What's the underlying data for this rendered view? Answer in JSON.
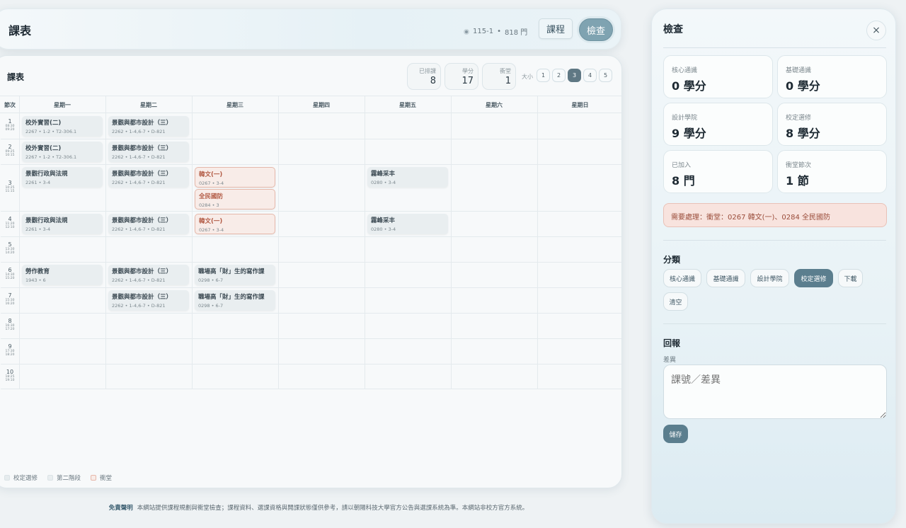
{
  "header": {
    "title": "課表",
    "term": "115-1",
    "term_sep": "•",
    "course_count": "818 門",
    "nav": [
      {
        "label": "課程"
      },
      {
        "label": "檢查"
      }
    ]
  },
  "schedule": {
    "title": "課表",
    "stats": [
      {
        "label": "已排課",
        "value": "8"
      },
      {
        "label": "學分",
        "value": "17"
      },
      {
        "label": "衝堂",
        "value": "1"
      }
    ],
    "size_label": "大小",
    "sizes": [
      "1",
      "2",
      "3",
      "4",
      "5"
    ],
    "selected_size": "3",
    "period_header": "節次",
    "days": [
      "星期一",
      "星期二",
      "星期三",
      "星期四",
      "星期五",
      "星期六",
      "星期日"
    ],
    "periods": [
      {
        "n": "1",
        "start": "08:30",
        "end": "09:20"
      },
      {
        "n": "2",
        "start": "09:25",
        "end": "10:15"
      },
      {
        "n": "3",
        "start": "10:25",
        "end": "11:15"
      },
      {
        "n": "4",
        "start": "11:20",
        "end": "12:10"
      },
      {
        "n": "5",
        "start": "13:30",
        "end": "14:20"
      },
      {
        "n": "6",
        "start": "14:30",
        "end": "15:20"
      },
      {
        "n": "7",
        "start": "15:30",
        "end": "16:20"
      },
      {
        "n": "8",
        "start": "16:30",
        "end": "17:20"
      },
      {
        "n": "9",
        "start": "17:30",
        "end": "18:20"
      },
      {
        "n": "10",
        "start": "18:25",
        "end": "19:10"
      }
    ],
    "courses": [
      {
        "name": "校外實習(二)",
        "meta": "2267 • 1-2 • T2-306.1",
        "day": 0,
        "period": 0,
        "slot": 0,
        "conflict": false
      },
      {
        "name": "校外實習(二)",
        "meta": "2267 • 1-2 • T2-306.1",
        "day": 0,
        "period": 1,
        "slot": 0,
        "conflict": false
      },
      {
        "name": "景觀行政與法規",
        "meta": "2261 • 3-4",
        "day": 0,
        "period": 2,
        "slot": 0,
        "conflict": false
      },
      {
        "name": "景觀行政與法規",
        "meta": "2261 • 3-4",
        "day": 0,
        "period": 3,
        "slot": 0,
        "conflict": false
      },
      {
        "name": "勞作教育",
        "meta": "1943 • 6",
        "day": 0,
        "period": 5,
        "slot": 0,
        "conflict": false
      },
      {
        "name": "景觀與都市設計（三）",
        "meta": "2262 • 1-4,6-7 • D-821",
        "day": 1,
        "period": 0,
        "slot": 0,
        "conflict": false
      },
      {
        "name": "景觀與都市設計（三）",
        "meta": "2262 • 1-4,6-7 • D-821",
        "day": 1,
        "period": 1,
        "slot": 0,
        "conflict": false
      },
      {
        "name": "景觀與都市設計（三）",
        "meta": "2262 • 1-4,6-7 • D-821",
        "day": 1,
        "period": 2,
        "slot": 0,
        "conflict": false
      },
      {
        "name": "景觀與都市設計（三）",
        "meta": "2262 • 1-4,6-7 • D-821",
        "day": 1,
        "period": 3,
        "slot": 0,
        "conflict": false
      },
      {
        "name": "景觀與都市設計（三）",
        "meta": "2262 • 1-4,6-7 • D-821",
        "day": 1,
        "period": 5,
        "slot": 0,
        "conflict": false
      },
      {
        "name": "景觀與都市設計（三）",
        "meta": "2262 • 1-4,6-7 • D-821",
        "day": 1,
        "period": 6,
        "slot": 0,
        "conflict": false
      },
      {
        "name": "韓文(一)",
        "meta": "0267 • 3-4",
        "day": 2,
        "period": 2,
        "slot": 0,
        "conflict": true
      },
      {
        "name": "全民國防",
        "meta": "0284 • 3",
        "day": 2,
        "period": 2,
        "slot": 1,
        "conflict": true
      },
      {
        "name": "韓文(一)",
        "meta": "0267 • 3-4",
        "day": 2,
        "period": 3,
        "slot": 0,
        "conflict": true
      },
      {
        "name": "職場高「財」生的寫作課",
        "meta": "0298 • 6-7",
        "day": 2,
        "period": 5,
        "slot": 0,
        "conflict": false
      },
      {
        "name": "職場高「財」生的寫作課",
        "meta": "0298 • 6-7",
        "day": 2,
        "period": 6,
        "slot": 0,
        "conflict": false
      },
      {
        "name": "霧峰采丰",
        "meta": "0280 • 3-4",
        "day": 4,
        "period": 2,
        "slot": 0,
        "conflict": false
      },
      {
        "name": "霧峰采丰",
        "meta": "0280 • 3-4",
        "day": 4,
        "period": 3,
        "slot": 0,
        "conflict": false
      }
    ],
    "legend": [
      {
        "label": "校定選修",
        "color": "#e6ecee"
      },
      {
        "label": "第二階段",
        "color": "#e9eef0"
      },
      {
        "label": "衝堂",
        "color": "#f8ece8"
      }
    ]
  },
  "footer": {
    "title": "免責聲明",
    "text": "本網站提供課程規劃與衝堂檢查；課程資料、選課資格與開課狀態僅供參考，請以朝陽科技大學官方公告與選課系統為準。本網站非校方官方系統。"
  },
  "panel": {
    "title": "檢查",
    "close_symbol": "×",
    "metrics": [
      {
        "label": "核心通識",
        "value": "0 學分"
      },
      {
        "label": "基礎通識",
        "value": "0 學分"
      },
      {
        "label": "設計學院",
        "value": "9 學分"
      },
      {
        "label": "校定選修",
        "value": "8 學分"
      },
      {
        "label": "已加入",
        "value": "8 門"
      },
      {
        "label": "衝堂節次",
        "value": "1 節"
      }
    ],
    "alert": "需要處理：衝堂：0267 韓文(一)、0284 全民國防",
    "category_title": "分類",
    "categories": [
      "核心通識",
      "基礎通識",
      "設計學院",
      "校定選修",
      "下載",
      "清空"
    ],
    "selected_category": "校定選修",
    "report_title": "回報",
    "diff_label": "差異",
    "diff_placeholder": "課號／差異",
    "save_label": "儲存"
  },
  "colors": {
    "accent": "#5b7e8e",
    "conflict": "#b25a44",
    "conflict_bg": "#f8ece8"
  }
}
